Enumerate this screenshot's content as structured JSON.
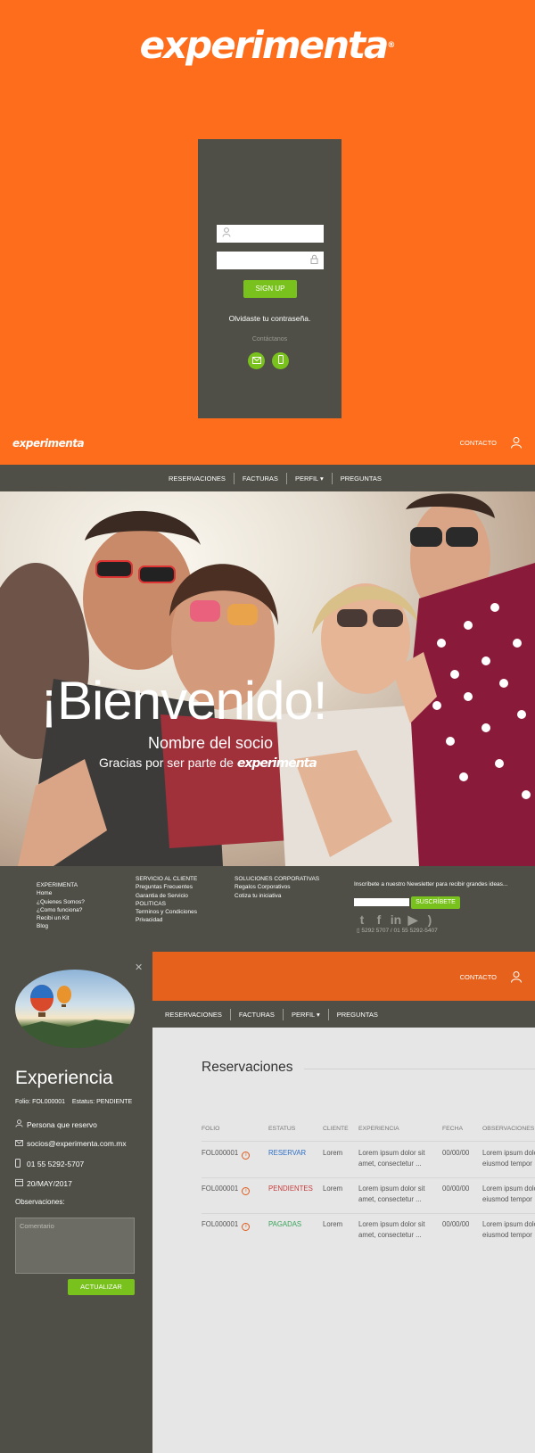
{
  "brand": {
    "logo_text": "experimenta",
    "registered_mark": "®",
    "orange": "#fe6d1b",
    "dark": "#4f4f47",
    "green": "#79c11c"
  },
  "login": {
    "user_icon": "user-icon",
    "lock_icon": "lock-icon",
    "signup_label": "SIGN UP",
    "forgot_text": "Olvidaste tu contraseña.",
    "contact_text": "Contáctanos",
    "mail_icon": "mail-icon",
    "phone_icon": "phone-icon"
  },
  "header": {
    "contact_label": "CONTACTO"
  },
  "nav": {
    "items": [
      "RESERVACIONES",
      "FACTURAS",
      "PERFIL ▾",
      "PREGUNTAS"
    ]
  },
  "hero": {
    "title": "¡Bienvenido!",
    "name": "Nombre del socio",
    "thanks": "Gracias por ser parte de",
    "brand": "experimenta"
  },
  "footer": {
    "col1": [
      "EXPERIMENTA",
      "Home",
      "¿Quienes Somos?",
      "¿Como funciona?",
      "Recibi un Kit",
      "Blog"
    ],
    "col2": [
      "SERVICIO AL CLIENTE",
      "Preguntas Frecuentes",
      "Garantia de Servicio",
      "POLITICAS",
      "Terminos y Condiciones",
      "Privacidad"
    ],
    "col3": [
      "SOLUCIONES CORPORATIVAS",
      "Regalos Corporativos",
      "Cotiza tu iniciativa"
    ],
    "newsletter_text": "Inscríbete a nuestro Newsletter para recibir grandes ideas...",
    "subscribe_label": "SUSCRÍBETE",
    "social": [
      "twitter-icon",
      "facebook-icon",
      "linkedin-icon",
      "youtube-icon",
      "rss-icon"
    ],
    "phones": "5292 5707 / 01 55 5292-5407"
  },
  "panel": {
    "title": "Experiencia",
    "folio_label": "Folio:",
    "folio_value": "FOL000001",
    "status_label": "Estatus:",
    "status_value": "PENDIENTE",
    "person": "Persona que reservo",
    "email": "socios@experimenta.com.mx",
    "phone": "01 55 5292-5707",
    "date": "20/MAY/2017",
    "obs_label": "Observaciones:",
    "comment_placeholder": "Comentario",
    "update_label": "ACTUALIZAR"
  },
  "dashboard": {
    "contact_label": "CONTACTO",
    "section_title": "Reservaciones",
    "columns": [
      "FOLIO",
      "ESTATUS",
      "CLIENTE",
      "EXPERIENCIA",
      "FECHA",
      "OBSERVACIONES"
    ],
    "rows": [
      {
        "folio": "FOL000001",
        "status": "RESERVAR",
        "status_color": "#2e6fc7",
        "client": "Lorem",
        "exp1": "Lorem ipsum dolor sit",
        "exp2": "amet, consectetur ...",
        "date": "00/00/00",
        "obs1": "Lorem ipsum dolor",
        "obs2": "eiusmod tempor"
      },
      {
        "folio": "FOL000001",
        "status": "PENDIENTES",
        "status_color": "#c93b3b",
        "client": "Lorem",
        "exp1": "Lorem ipsum dolor sit",
        "exp2": "amet, consectetur ...",
        "date": "00/00/00",
        "obs1": "Lorem ipsum dolor",
        "obs2": "eiusmod tempor"
      },
      {
        "folio": "FOL000001",
        "status": "PAGADAS",
        "status_color": "#3aa35a",
        "client": "Lorem",
        "exp1": "Lorem ipsum dolor sit",
        "exp2": "amet, consectetur ...",
        "date": "00/00/00",
        "obs1": "Lorem ipsum dolor",
        "obs2": "eiusmod tempor"
      }
    ]
  }
}
